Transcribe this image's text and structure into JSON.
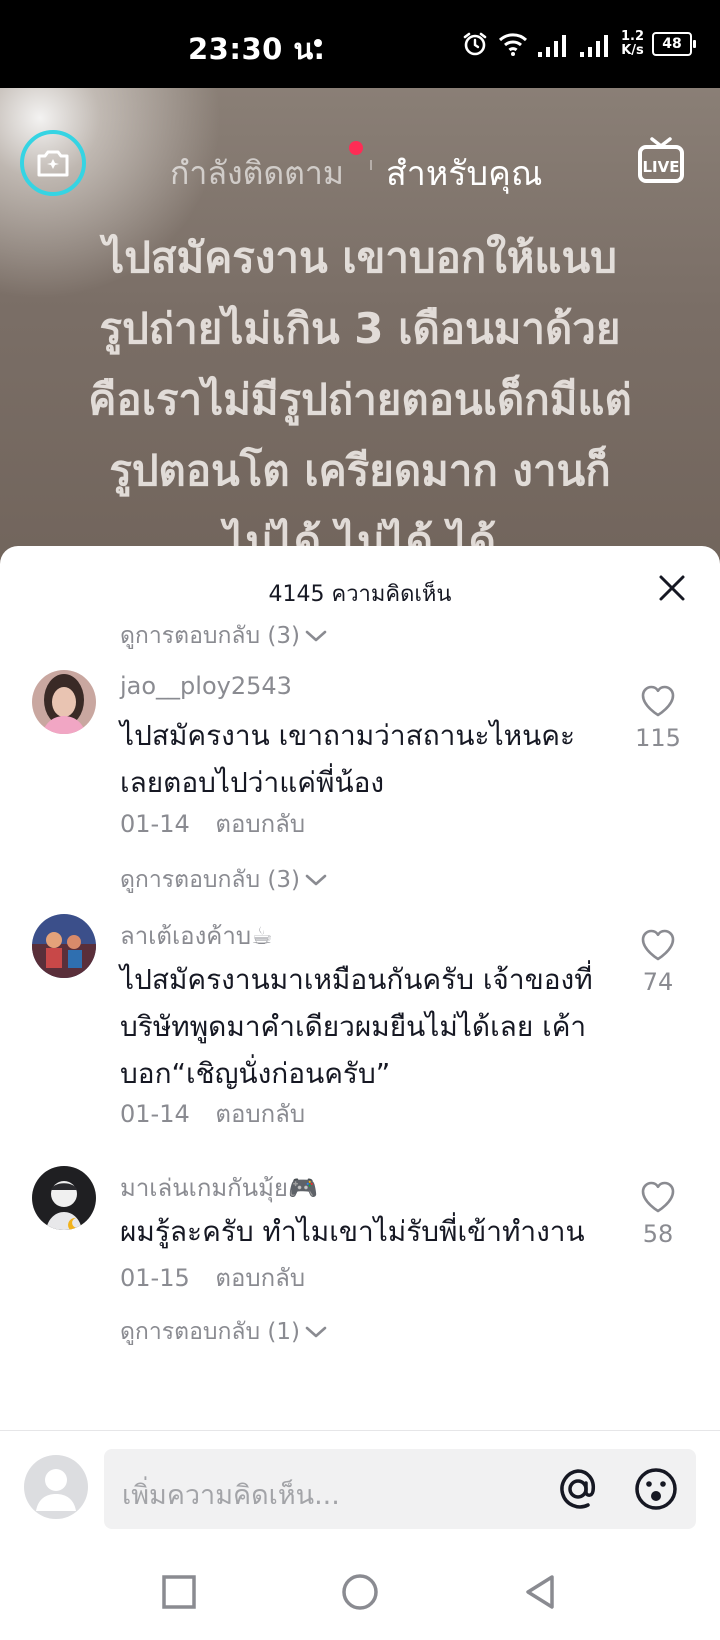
{
  "status_bar": {
    "time": "23:30 น.",
    "net_speed_value": "1.2",
    "net_speed_unit": "K/s",
    "battery": "48"
  },
  "top_nav": {
    "following": "กำลังติดตาม",
    "for_you": "สำหรับคุณ",
    "accent_color": "#fe2c55",
    "camera_ring_color": "#35d4e3"
  },
  "video": {
    "caption_lines": [
      "ไปสมัครงาน เขาบอกให้แนบ",
      "รูปถ่ายไม่เกิน 3 เดือนมาด้วย",
      "คือเราไม่มีรูปถ่ายตอนเด็กมีแต่",
      "รูปตอนโต เครียดมาก งานก็",
      "ไม่ได้ ไม่ได้ ได้"
    ]
  },
  "comments_panel": {
    "count_label": "4145 ความคิดเห็น",
    "top_replies": "ดูการตอบกลับ (3)",
    "comments": [
      {
        "username": "jao__ploy2543",
        "text": "ไปสมัครงาน เขาถามว่าสถานะไหนคะ เลยตอบไปว่าแค่พี่น้อง",
        "date": "01-14",
        "reply": "ตอบกลับ",
        "likes": "115",
        "view_replies": "ดูการตอบกลับ (3)"
      },
      {
        "username": "ลาเต้เองค้าบ☕",
        "text": "ไปสมัครงานมาเหมือนกันครับ เจ้าของที่บริษัทพูดมาคำเดียวผมยืนไม่ได้เลย เค้าบอก“เชิญนั่งก่อนครับ”",
        "date": "01-14",
        "reply": "ตอบกลับ",
        "likes": "74"
      },
      {
        "username": "มาเล่นเกมกันมุ้ย🎮",
        "text": "ผมรู้ละครับ ทำไมเขาไม่รับพี่เข้าทำงาน",
        "date": "01-15",
        "reply": "ตอบกลับ",
        "likes": "58",
        "view_replies": "ดูการตอบกลับ (1)"
      }
    ]
  },
  "input_bar": {
    "placeholder": "เพิ่มความคิดเห็น..."
  }
}
